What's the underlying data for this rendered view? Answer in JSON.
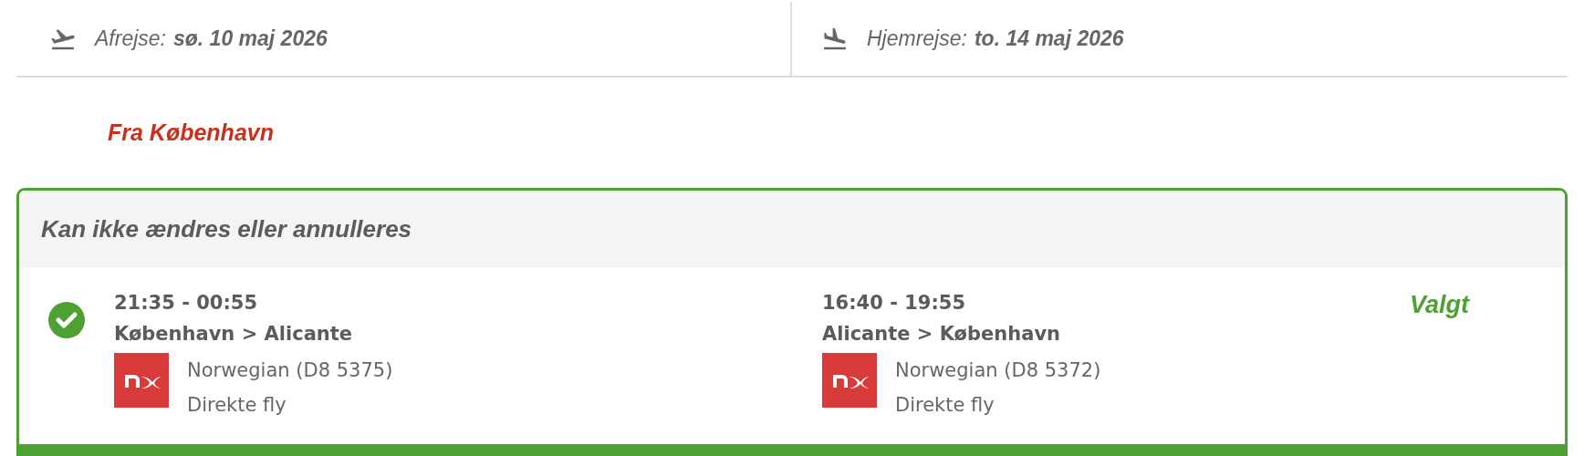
{
  "dates": [
    {
      "kind": "outbound",
      "label": "Afrejse:",
      "value": "sø. 10 maj 2026"
    },
    {
      "kind": "return",
      "label": "Hjemrejse:",
      "value": "to. 14 maj 2026"
    }
  ],
  "origin_heading": "Fra København",
  "fare": {
    "title": "Kan ikke ændres eller annulleres",
    "selected": true,
    "status": "Valgt",
    "legs": [
      {
        "time": "21:35 - 00:55",
        "route": "København > Alicante",
        "carrier": "Norwegian (D8 5375)",
        "type": "Direkte fly"
      },
      {
        "time": "16:40 - 19:55",
        "route": "Alicante > København",
        "carrier": "Norwegian (D8 5372)",
        "type": "Direkte fly"
      }
    ]
  }
}
